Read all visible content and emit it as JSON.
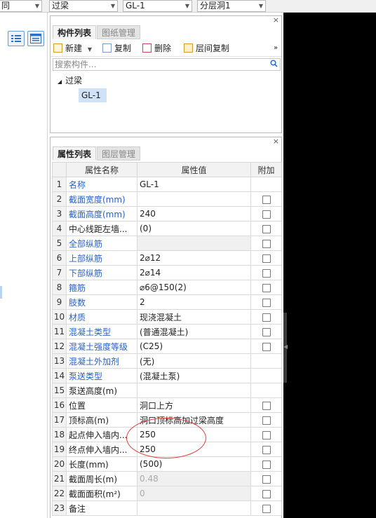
{
  "topbar": {
    "combo_left": "同",
    "combo_type": "过梁",
    "combo_name": "GL-1",
    "combo_layer": "分层洞1"
  },
  "component_panel": {
    "tabs": [
      "构件列表",
      "图纸管理"
    ],
    "toolbar": {
      "new_label": "新建",
      "copy_label": "复制",
      "delete_label": "删除",
      "floor_copy_label": "层间复制",
      "more_label": "»"
    },
    "search_placeholder": "搜索构件...",
    "tree": {
      "root_label": "过梁",
      "child_label": "GL-1"
    }
  },
  "property_panel": {
    "tabs": [
      "属性列表",
      "图层管理"
    ],
    "columns": [
      "属性名称",
      "属性值",
      "附加"
    ],
    "rows": [
      {
        "no": "1",
        "name": "名称",
        "value": "GL-1",
        "link": true,
        "checkbox": false,
        "disabled": false
      },
      {
        "no": "2",
        "name": "截面宽度(mm)",
        "value": "",
        "link": true,
        "checkbox": true,
        "disabled": false
      },
      {
        "no": "3",
        "name": "截面高度(mm)",
        "value": "240",
        "link": true,
        "checkbox": true,
        "disabled": false
      },
      {
        "no": "4",
        "name": "中心线距左墙...",
        "value": "(0)",
        "link": false,
        "checkbox": true,
        "disabled": false
      },
      {
        "no": "5",
        "name": "全部纵筋",
        "value": "",
        "link": true,
        "checkbox": true,
        "disabled": true
      },
      {
        "no": "6",
        "name": "上部纵筋",
        "value": "2⌀12",
        "link": true,
        "checkbox": true,
        "disabled": false
      },
      {
        "no": "7",
        "name": "下部纵筋",
        "value": "2⌀14",
        "link": true,
        "checkbox": true,
        "disabled": false
      },
      {
        "no": "8",
        "name": "箍筋",
        "value": "⌀6@150(2)",
        "link": true,
        "checkbox": true,
        "disabled": false
      },
      {
        "no": "9",
        "name": "肢数",
        "value": "2",
        "link": true,
        "checkbox": true,
        "disabled": false
      },
      {
        "no": "10",
        "name": "材质",
        "value": "现浇混凝土",
        "link": true,
        "checkbox": true,
        "disabled": false
      },
      {
        "no": "11",
        "name": "混凝土类型",
        "value": "(普通混凝土)",
        "link": true,
        "checkbox": true,
        "disabled": false
      },
      {
        "no": "12",
        "name": "混凝土强度等级",
        "value": "(C25)",
        "link": true,
        "checkbox": true,
        "disabled": false
      },
      {
        "no": "13",
        "name": "混凝土外加剂",
        "value": "(无)",
        "link": true,
        "checkbox": false,
        "disabled": false
      },
      {
        "no": "14",
        "name": "泵送类型",
        "value": "(混凝土泵)",
        "link": true,
        "checkbox": false,
        "disabled": false
      },
      {
        "no": "15",
        "name": "泵送高度(m)",
        "value": "",
        "link": false,
        "checkbox": false,
        "disabled": false
      },
      {
        "no": "16",
        "name": "位置",
        "value": "洞口上方",
        "link": false,
        "checkbox": true,
        "disabled": false
      },
      {
        "no": "17",
        "name": "顶标高(m)",
        "value": "洞口顶标高加过梁高度",
        "link": false,
        "checkbox": true,
        "disabled": false
      },
      {
        "no": "18",
        "name": "起点伸入墙内...",
        "value": "250",
        "link": false,
        "checkbox": true,
        "disabled": false
      },
      {
        "no": "19",
        "name": "终点伸入墙内...",
        "value": "250",
        "link": false,
        "checkbox": true,
        "disabled": false
      },
      {
        "no": "20",
        "name": "长度(mm)",
        "value": "(500)",
        "link": false,
        "checkbox": true,
        "disabled": false
      },
      {
        "no": "21",
        "name": "截面周长(m)",
        "value": "0.48",
        "link": false,
        "checkbox": true,
        "disabled": true
      },
      {
        "no": "22",
        "name": "截面面积(m²)",
        "value": "0",
        "link": false,
        "checkbox": true,
        "disabled": true
      },
      {
        "no": "23",
        "name": "备注",
        "value": "",
        "link": false,
        "checkbox": true,
        "disabled": false
      }
    ]
  },
  "colors": {
    "link_text": "#2a62c3",
    "annotation_ring": "#e23b3b",
    "selection": "#cfe2f7"
  }
}
